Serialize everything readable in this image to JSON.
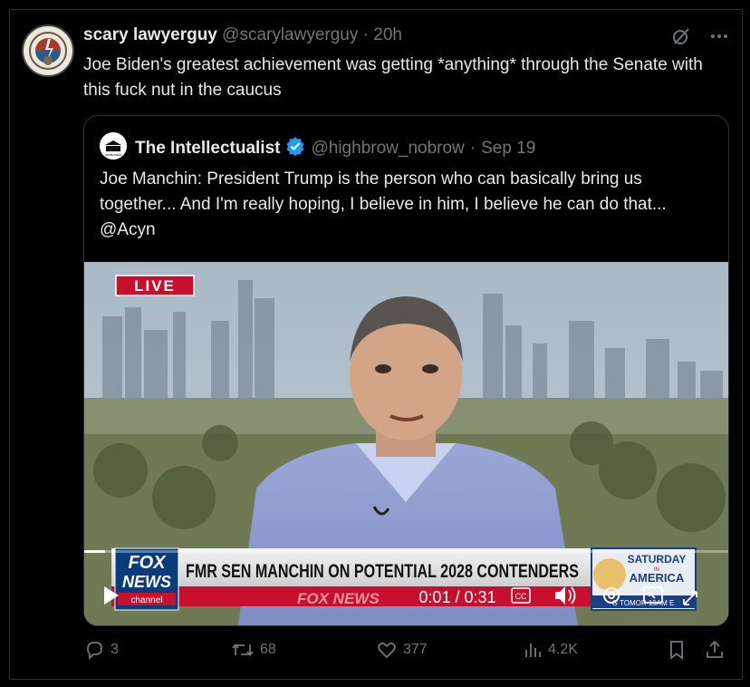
{
  "tweet": {
    "author_name": "scary lawyerguy",
    "author_handle": "@scarylawyerguy",
    "separator": "·",
    "time": "20h",
    "text": "Joe Biden's greatest achievement was getting *anything* through the Senate with this fuck nut in the caucus"
  },
  "quoted": {
    "author_name": "The Intellectualist",
    "author_handle": "@highbrow_nobrow",
    "separator": "·",
    "date": "Sep 19",
    "text": "Joe Manchin: President Trump is the person who can basically bring us together... And I'm really hoping, I believe in him, I believe he can do that... @Acyn",
    "avatar_small_text": "Intellectualist"
  },
  "video": {
    "live_label": "LIVE",
    "lower_third": "FMR SEN MANCHIN ON POTENTIAL 2028 CONTENDERS",
    "network_top": "FOX",
    "network_mid": "NEWS",
    "network_bottom": "channel",
    "ticker_brand": "FOX NEWS",
    "time_current": "0:01",
    "time_sep": "/",
    "time_total": "0:31",
    "cc_label": "CC",
    "promo_title": "SATURDAY",
    "promo_in": "IN",
    "promo_subtitle": "AMERICA",
    "promo_ticker": "G TOMOR    10AM E"
  },
  "actions": {
    "replies": "3",
    "reposts": "68",
    "likes": "377",
    "views": "4.2K"
  },
  "colors": {
    "background": "#000000",
    "text": "#e7e9ea",
    "muted": "#71767b",
    "verified": "#1d9bf0",
    "border": "#2f3336",
    "live_red": "#c8102e"
  }
}
